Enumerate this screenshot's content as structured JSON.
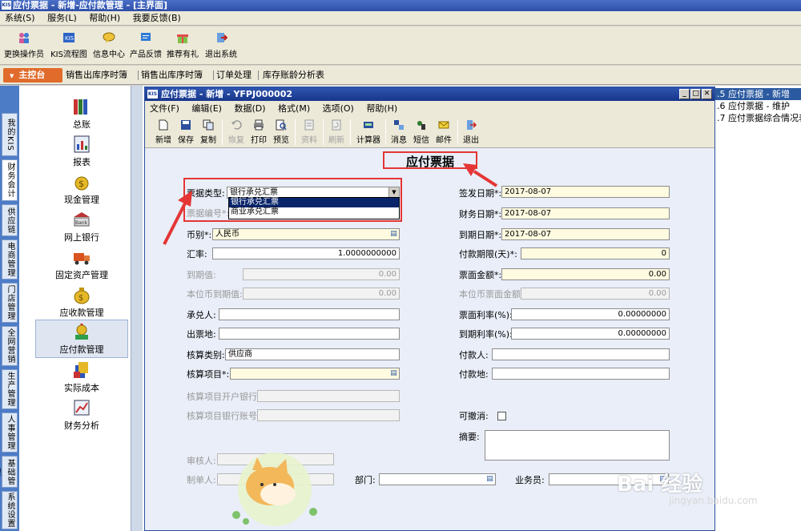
{
  "app": {
    "title": "应付票据 - 新增-应付款管理 - [主界面]",
    "logo": "KIS",
    "menu": [
      "系统(S)",
      "服务(L)",
      "帮助(H)",
      "我要反馈(B)"
    ]
  },
  "toolbar": [
    "更换操作员",
    "KIS流程图",
    "信息中心",
    "产品反馈",
    "推荐有礼",
    "退出系统"
  ],
  "nav_tabs": {
    "main": "主控台",
    "tabs": [
      "销售出库序时簿",
      "销售出库序时簿",
      "订单处理",
      "库存账龄分析表"
    ]
  },
  "left_tabs": [
    "我的KIS",
    "财务会计",
    "供应链",
    "电商管理",
    "门店管理",
    "全网营销",
    "生产管理",
    "人事管理",
    "基础管理",
    "系统设置"
  ],
  "function_panel": [
    {
      "label": "总账",
      "icon": "books-icon"
    },
    {
      "label": "报表",
      "icon": "report-icon"
    },
    {
      "label": "现金管理",
      "icon": "cash-icon"
    },
    {
      "label": "网上银行",
      "icon": "bank-icon"
    },
    {
      "label": "固定资产管理",
      "icon": "truck-icon"
    },
    {
      "label": "应收款管理",
      "icon": "money-bag-icon"
    },
    {
      "label": "应付款管理",
      "icon": "payable-icon"
    },
    {
      "label": "实际成本",
      "icon": "cost-icon"
    },
    {
      "label": "财务分析",
      "icon": "analysis-icon"
    }
  ],
  "right_list": [
    ".5  应付票据 - 新增",
    ".6  应付票据 - 维护",
    ".7  应付票据综合情况表"
  ],
  "dialog": {
    "title": "应付票据 - 新增 - YFPJ000002",
    "logo": "KIS",
    "menu": [
      "文件(F)",
      "编辑(E)",
      "数据(D)",
      "格式(M)",
      "选项(O)",
      "帮助(H)"
    ],
    "toolbar": [
      {
        "label": "新增",
        "enabled": true
      },
      {
        "label": "保存",
        "enabled": true
      },
      {
        "label": "复制",
        "enabled": true
      },
      {
        "label": "恢复",
        "enabled": false
      },
      {
        "label": "打印",
        "enabled": true
      },
      {
        "label": "预览",
        "enabled": true
      },
      {
        "label": "资料",
        "enabled": false
      },
      {
        "label": "刷新",
        "enabled": false
      },
      {
        "label": "计算器",
        "enabled": true
      },
      {
        "label": "消息",
        "enabled": true
      },
      {
        "label": "短信",
        "enabled": true
      },
      {
        "label": "邮件",
        "enabled": true
      },
      {
        "label": "退出",
        "enabled": true
      }
    ],
    "form_title": "应付票据",
    "fields": {
      "bill_type_label": "票据类型:",
      "bill_type_value": "银行承兑汇票",
      "bill_type_options": [
        "银行承兑汇票",
        "商业承兑汇票"
      ],
      "bill_no_label": "票据编号*:",
      "currency_label": "币别*:",
      "currency_value": "人民币",
      "rate_label": "汇率:",
      "rate_value": "1.0000000000",
      "maturity_value_label": "到期值:",
      "maturity_value": "0.00",
      "local_maturity_label": "本位币到期值:",
      "local_maturity_value": "0.00",
      "acceptor_label": "承兑人:",
      "issue_place_label": "出票地:",
      "account_type_label": "核算类别:",
      "account_type_value": "供应商",
      "account_item_label": "核算项目*:",
      "item_bank_label": "核算项目开户银行:",
      "item_bank_no_label": "核算项目银行账号:",
      "issue_date_label": "签发日期*:",
      "issue_date_value": "2017-08-07",
      "fin_date_label": "财务日期*:",
      "fin_date_value": "2017-08-07",
      "due_date_label": "到期日期*:",
      "due_date_value": "2017-08-07",
      "term_label": "付款期限(天)*:",
      "term_value": "0",
      "face_amount_label": "票面金额*:",
      "face_amount_value": "0.00",
      "local_face_label": "本位币票面金额:",
      "local_face_value": "0.00",
      "face_rate_label": "票面利率(%):",
      "face_rate_value": "0.00000000",
      "due_rate_label": "到期利率(%):",
      "due_rate_value": "0.00000000",
      "payer_label": "付款人:",
      "pay_place_label": "付款地:",
      "revocable_label": "可撤消:",
      "summary_label": "摘要:",
      "auditor_label": "审核人:",
      "maker_label": "制单人:",
      "dept_label": "部门:",
      "salesman_label": "业务员:"
    }
  },
  "watermark": {
    "main": "Bai 经验",
    "sub": "jingyan.baidu.com"
  },
  "colors": {
    "accent_red": "#e53535",
    "title_blue": "#2f56b0",
    "required_yellow": "#fffbe0",
    "main_tab_orange": "#e06b2b"
  }
}
